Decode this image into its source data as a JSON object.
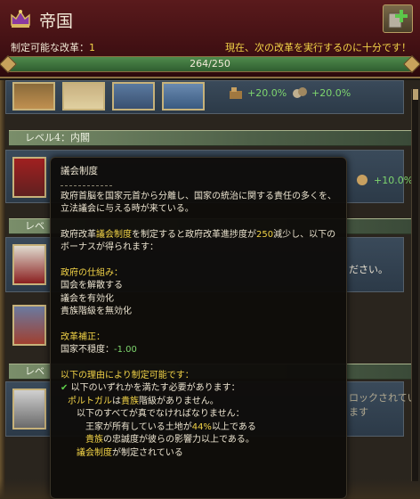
{
  "header": {
    "title": "帝国",
    "enactable_label": "制定可能な改革：",
    "enactable_count": "1",
    "status": "現在、次の改革を実行するのに十分です！",
    "progress_text": "264/250",
    "progress_fraction": 1.0
  },
  "list": {
    "row1_mods": [
      "+20.0%",
      "+20.0%"
    ],
    "level4_banner": "レベル4：内閣",
    "row2_mod": "+10.0%",
    "level5_banner": "レベ",
    "level6_banner": "レベ",
    "bg_text_1": "ださい。",
    "bg_text_2": "ロックされています"
  },
  "tooltip": {
    "title": "議会制度",
    "description": "政府首脳を国家元首から分離し、国家の統治に関する責任の多くを、立法議会に与える時が来ている。",
    "enact_pre": "政府改革",
    "enact_reform": "議会制度",
    "enact_mid": "を制定すると政府改革進捗度が",
    "enact_value": "250",
    "enact_post": "減少し、以下のボーナスが得られます：",
    "mechanics_header": "政府の仕組み：",
    "mechanics": [
      "国会を解散する",
      "議会を有効化",
      "貴族階級を無効化"
    ],
    "modifiers_header": "改革補正：",
    "modifier_label": "国家不穏度：",
    "modifier_value": "-1.00",
    "reasons_header": "以下の理由により制定可能です：",
    "req_any": "以下のいずれかを満たす必要があります：",
    "req_country": "ポルトガル",
    "req_country_mid": "は",
    "req_estate": "貴族",
    "req_country_post": "階級がありません。",
    "req_all": "以下のすべてが真でなければなりません：",
    "req_land_pre": "王家が所有している土地が",
    "req_land_value": "44%",
    "req_land_post": "以上である",
    "req_loyalty_estate": "貴族",
    "req_loyalty_post": "の忠誠度が彼らの影響力以上である。",
    "req_enacted_reform": "議会制度",
    "req_enacted_post": "が制定されている"
  }
}
